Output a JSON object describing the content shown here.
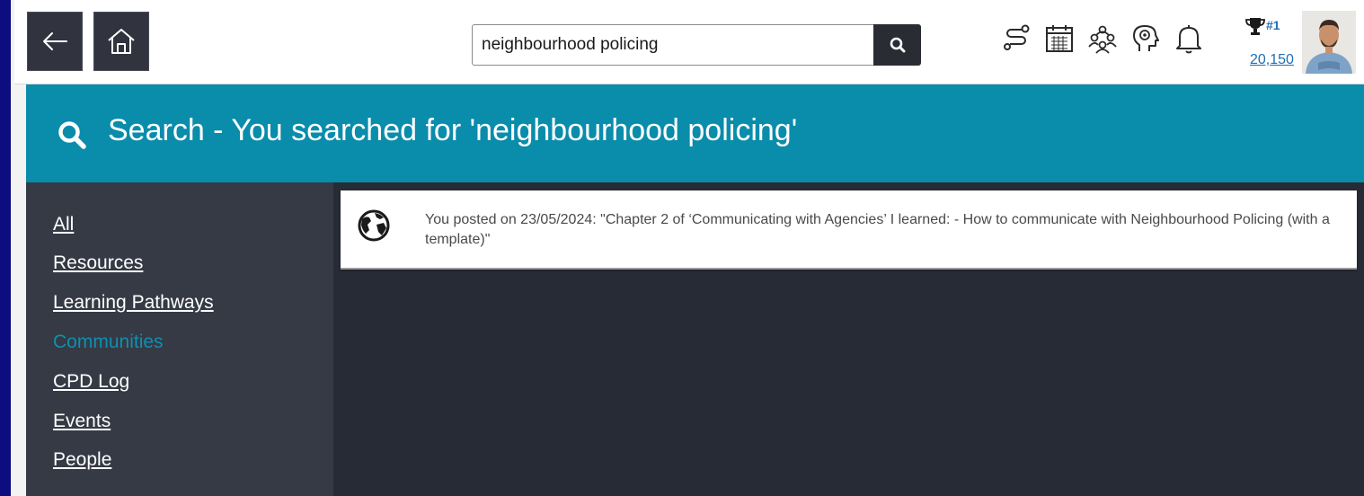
{
  "search": {
    "value": "neighbourhood policing"
  },
  "toolbar": {
    "rank": "#1",
    "points": "20,150"
  },
  "header": {
    "title": "Search - You searched for 'neighbourhood policing'"
  },
  "sidebar": {
    "items": [
      {
        "label": "All"
      },
      {
        "label": "Resources"
      },
      {
        "label": "Learning Pathways"
      },
      {
        "label": "Communities",
        "active": true
      },
      {
        "label": "CPD Log"
      },
      {
        "label": "Events"
      },
      {
        "label": "People"
      }
    ]
  },
  "results": [
    {
      "icon": "globe-icon",
      "text": "You posted on 23/05/2024: \"Chapter 2 of ‘Communicating with Agencies’ I learned: - How to communicate with Neighbourhood Policing (with a template)\""
    }
  ],
  "colors": {
    "accent": "#0a8cab",
    "sidebar_bg": "#353a45",
    "main_bg": "#272b36",
    "active_link": "#0f8fb0"
  }
}
